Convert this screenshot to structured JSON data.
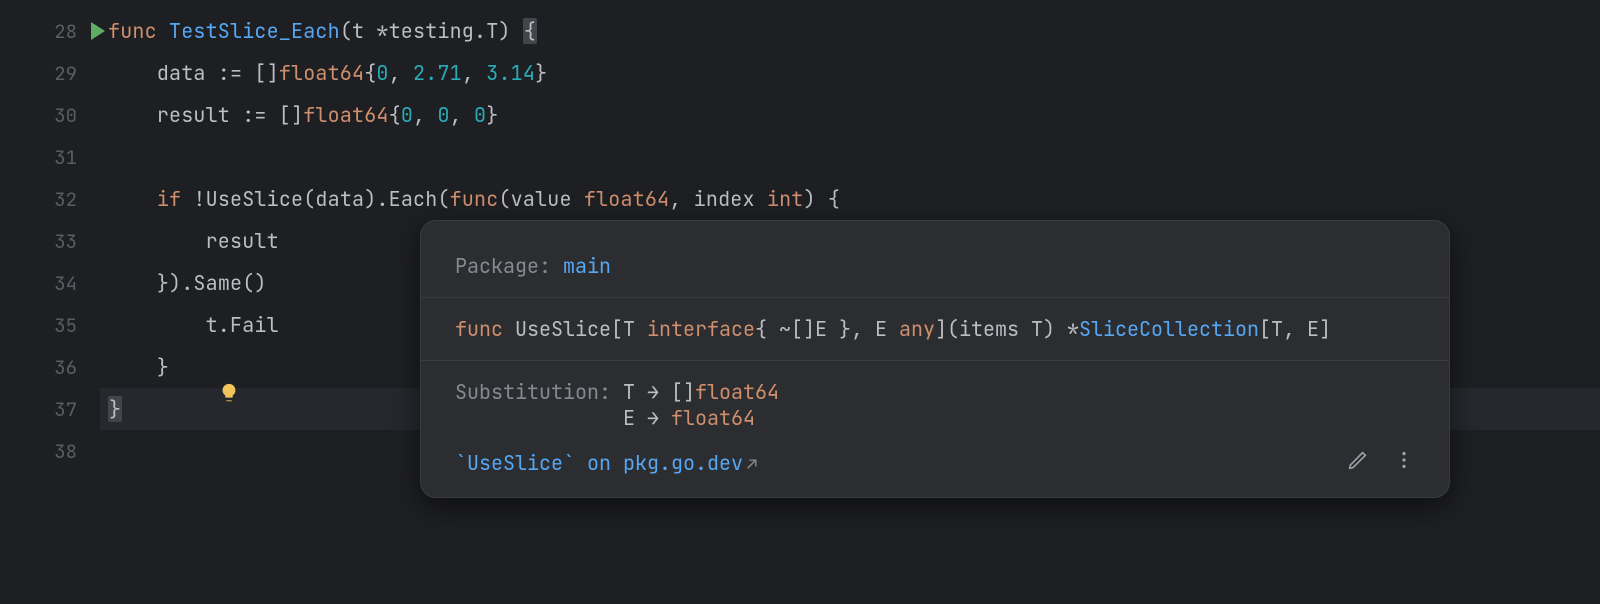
{
  "gutter": {
    "start": 28,
    "lines": [
      "28",
      "29",
      "30",
      "31",
      "32",
      "33",
      "34",
      "35",
      "36",
      "37",
      "38"
    ]
  },
  "code": {
    "l28": {
      "kw": "func ",
      "fn": "TestSlice_Each",
      "rest1": "(t *testing.T) ",
      "brace": "{"
    },
    "l29": {
      "indent": "    ",
      "id": "data := []",
      "type": "float64",
      "rest": "{",
      "n1": "0",
      "c1": ", ",
      "n2": "2.71",
      "c2": ", ",
      "n3": "3.14",
      "end": "}"
    },
    "l30": {
      "indent": "    ",
      "id": "result := []",
      "type": "float64",
      "rest": "{",
      "n1": "0",
      "c1": ", ",
      "n2": "0",
      "c2": ", ",
      "n3": "0",
      "end": "}"
    },
    "l32": {
      "indent": "    ",
      "kw": "if ",
      "bang": "!",
      "fn1": "UseSlice",
      "p1": "(data).",
      "fn2": "Each",
      "p2": "(",
      "kw2": "func",
      "p3": "(value ",
      "type1": "float64",
      "p4": ", index ",
      "type2": "int",
      "p5": ") {"
    },
    "l33": {
      "indent": "        ",
      "txt": "result"
    },
    "l34": {
      "indent": "    ",
      "txt": "}).",
      "fn": "Same",
      "rest": "()"
    },
    "l35": {
      "indent": "        ",
      "txt": "t.",
      "fn": "Fail"
    },
    "l36": {
      "indent": "    ",
      "txt": "}"
    },
    "l37": {
      "txt": "}"
    }
  },
  "tooltip": {
    "pkg_label": "Package: ",
    "pkg_name": "main",
    "sig": {
      "kw": "func ",
      "name": "UseSlice",
      "open": "[T ",
      "iface": "interface",
      "constraint": "{ ~[]E }",
      "sep": ", E ",
      "any": "any",
      "close": "](items T) *",
      "ret": "SliceCollection",
      "ret_params": "[T, E]"
    },
    "sub_label": "Substitution: ",
    "sub1_l": "T → []",
    "sub1_r": "float64",
    "sub2_pad": "              ",
    "sub2_l": "E → ",
    "sub2_r": "float64",
    "link": "`UseSlice` on pkg.go.dev"
  }
}
